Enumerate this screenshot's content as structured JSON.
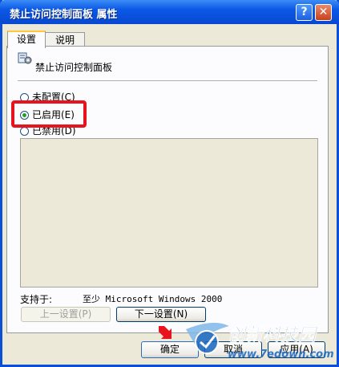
{
  "window": {
    "title": "禁止访问控制面板 属性",
    "help_glyph": "?",
    "close_glyph": "✕"
  },
  "tabs": [
    {
      "label": "设置"
    },
    {
      "label": "说明"
    }
  ],
  "policy": {
    "title": "禁止访问控制面板",
    "icon": "policy-setting-icon"
  },
  "options": [
    {
      "label": "未配置(C)",
      "checked": false
    },
    {
      "label": "已启用(E)",
      "checked": true
    },
    {
      "label": "已禁用(D)",
      "checked": false
    }
  ],
  "support": {
    "label": "支持于:",
    "value": "至少 Microsoft Windows 2000"
  },
  "buttons": {
    "prev": "上一设置(P)",
    "next": "下一设置(N)",
    "ok": "确定",
    "cancel": "取消",
    "apply": "应用(A)"
  },
  "watermark": {
    "brand": "创新科技园",
    "url": "www.7edown.com"
  },
  "colors": {
    "titlebar": "#0a58e6",
    "highlight": "#e8141d",
    "arrow": "#e8141d"
  }
}
